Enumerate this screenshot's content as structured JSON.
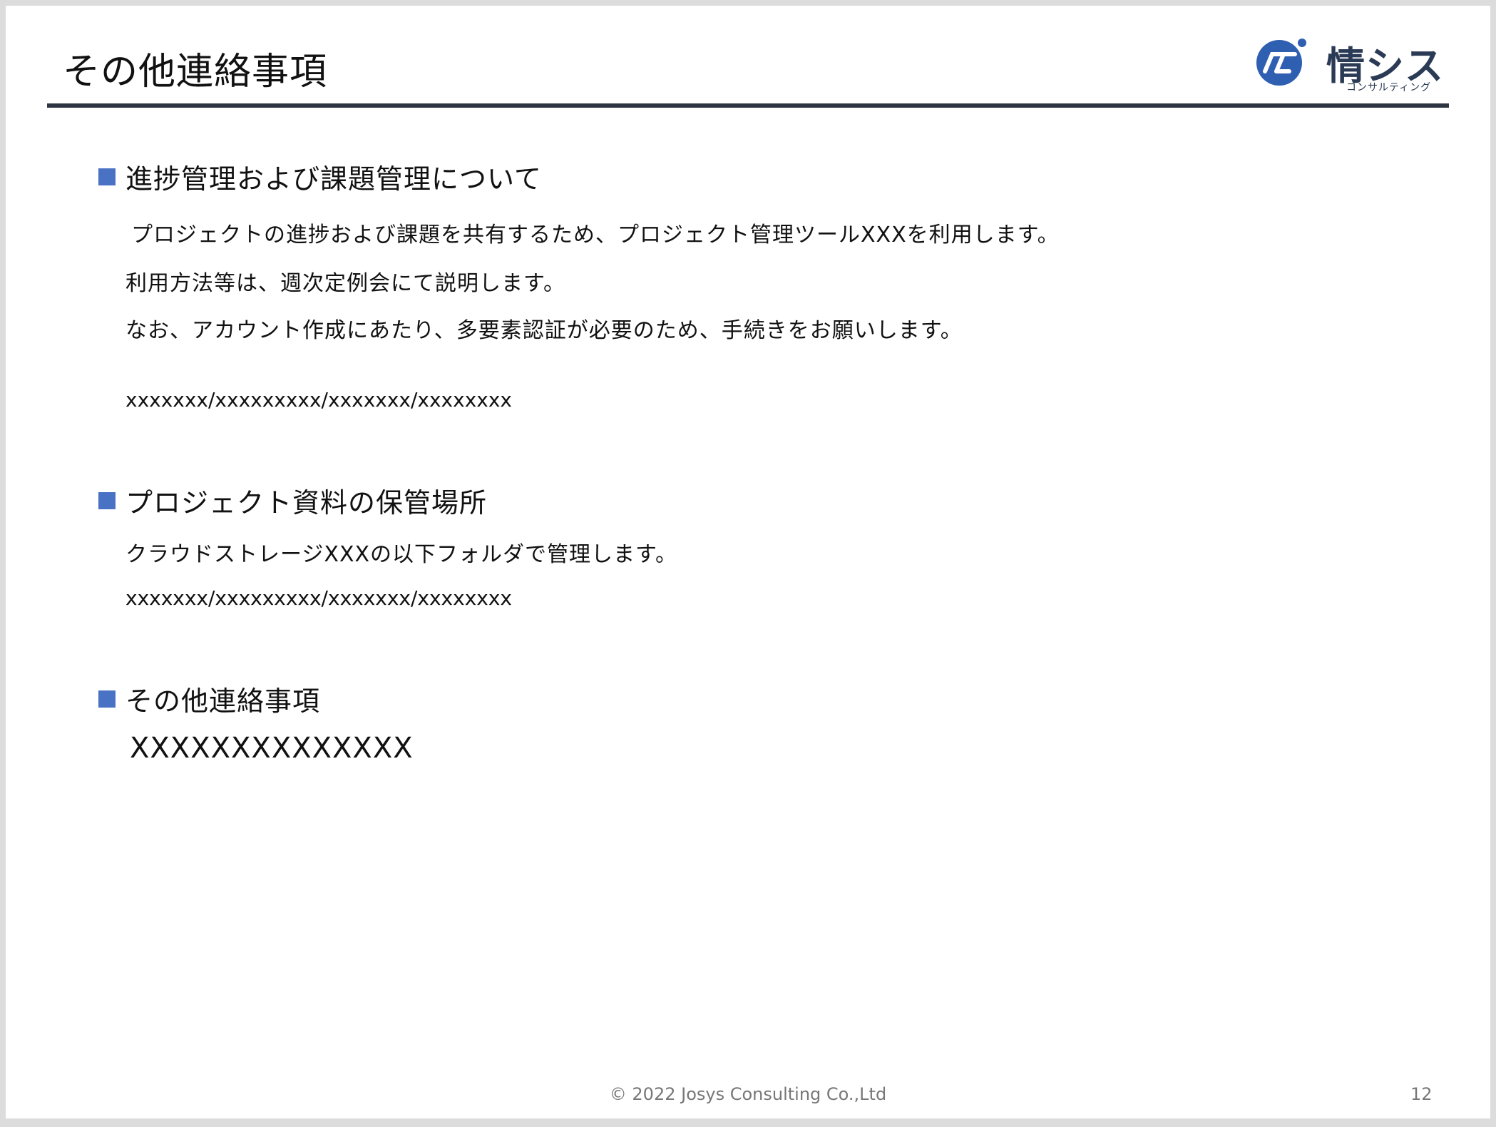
{
  "slide": {
    "title": "その他連絡事項",
    "logo": {
      "text": "情シス",
      "subtext": "コンサルティング",
      "brand_color": "#2b3a55",
      "mark_color": "#2f5fb0"
    },
    "sections": [
      {
        "heading": "進捗管理および課題管理について",
        "lines": [
          "プロジェクトの進捗および課題を共有するため、プロジェクト管理ツールXXXを利用します。",
          "利用方法等は、週次定例会にて説明します。",
          "なお、アカウント作成にあたり、多要素認証が必要のため、手続きをお願いします。"
        ],
        "path": "xxxxxxx/xxxxxxxxx/xxxxxxx/xxxxxxxx"
      },
      {
        "heading": "プロジェクト資料の保管場所",
        "lines": [
          "クラウドストレージXXXの以下フォルダで管理します。"
        ],
        "path": "xxxxxxx/xxxxxxxxx/xxxxxxx/xxxxxxxx"
      },
      {
        "heading": "その他連絡事項",
        "text": "XXXXXXXXXXXXXX"
      }
    ],
    "footer": {
      "copyright": "© 2022 Josys Consulting Co.,Ltd",
      "page_number": "12"
    },
    "colors": {
      "bullet": "#4a72c4",
      "title_rule": "#2e3542"
    }
  }
}
